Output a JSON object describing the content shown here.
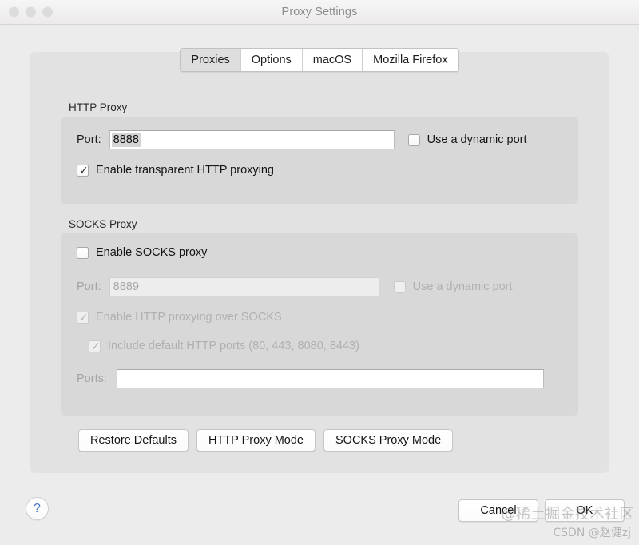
{
  "window": {
    "title": "Proxy Settings",
    "traffic_lights": [
      "close",
      "minimize",
      "zoom"
    ]
  },
  "tabs": [
    {
      "label": "Proxies",
      "selected": true
    },
    {
      "label": "Options",
      "selected": false
    },
    {
      "label": "macOS",
      "selected": false
    },
    {
      "label": "Mozilla Firefox",
      "selected": false
    }
  ],
  "http_proxy": {
    "group_label": "HTTP Proxy",
    "port_label": "Port:",
    "port_value": "8888",
    "port_value_selected": true,
    "dynamic_port_label": "Use a dynamic port",
    "dynamic_port_checked": false,
    "transparent_label": "Enable transparent HTTP proxying",
    "transparent_checked": true,
    "checkmark": "✓"
  },
  "socks_proxy": {
    "group_label": "SOCKS Proxy",
    "enable_label": "Enable SOCKS proxy",
    "enable_checked": false,
    "port_label": "Port:",
    "port_value": "8889",
    "dynamic_port_label": "Use a dynamic port",
    "dynamic_port_checked": false,
    "http_over_socks_label": "Enable HTTP proxying over SOCKS",
    "http_over_socks_checked": true,
    "default_ports_label": "Include default HTTP ports (80, 443, 8080, 8443)",
    "default_ports_checked": true,
    "ports_label": "Ports:",
    "ports_value": "",
    "disabled": true,
    "checkmark": "✓"
  },
  "mode_buttons": [
    {
      "label": "Restore Defaults"
    },
    {
      "label": "HTTP Proxy Mode"
    },
    {
      "label": "SOCKS Proxy Mode"
    }
  ],
  "footer": {
    "help_glyph": "?",
    "cancel_label": "Cancel",
    "ok_label": "OK"
  },
  "watermark": {
    "line1": "@稀土掘金技术社区",
    "line2": "CSDN @赵健zj"
  },
  "colors": {
    "window_bg": "#ececec",
    "panel_bg": "#e2e2e2",
    "group_bg": "#d8d8d8",
    "accent_blue": "#4a78c8",
    "disabled_text": "#b0b0b0"
  }
}
